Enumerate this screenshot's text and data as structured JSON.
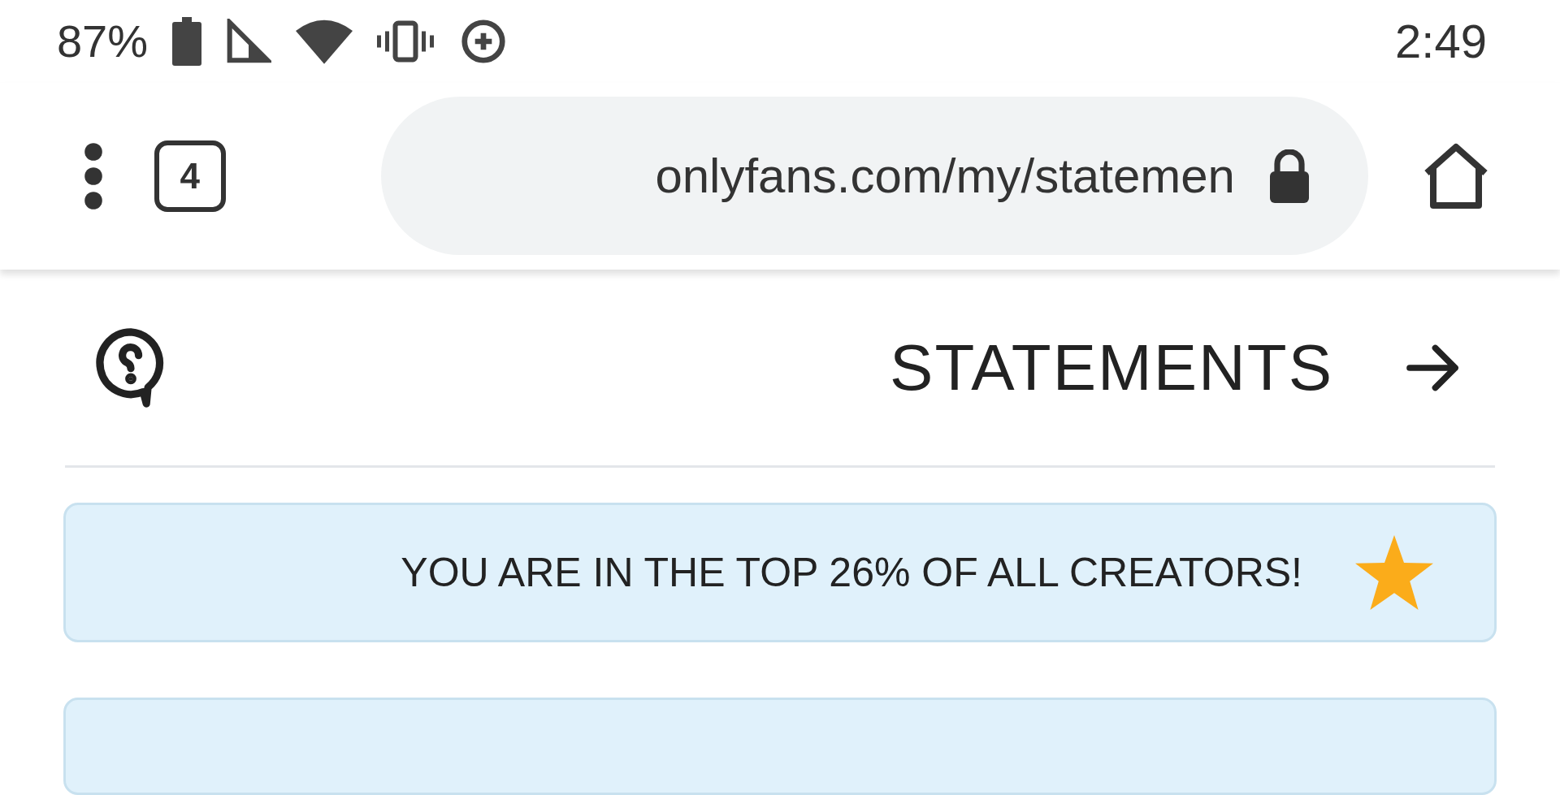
{
  "status_bar": {
    "time": "2:49",
    "battery": "87%"
  },
  "browser": {
    "url": "onlyfans.com/my/statemen",
    "tab_count": "4"
  },
  "header": {
    "title": "STATEMENTS"
  },
  "banner": {
    "text": "YOU ARE IN THE TOP 26% OF ALL CREATORS!"
  }
}
